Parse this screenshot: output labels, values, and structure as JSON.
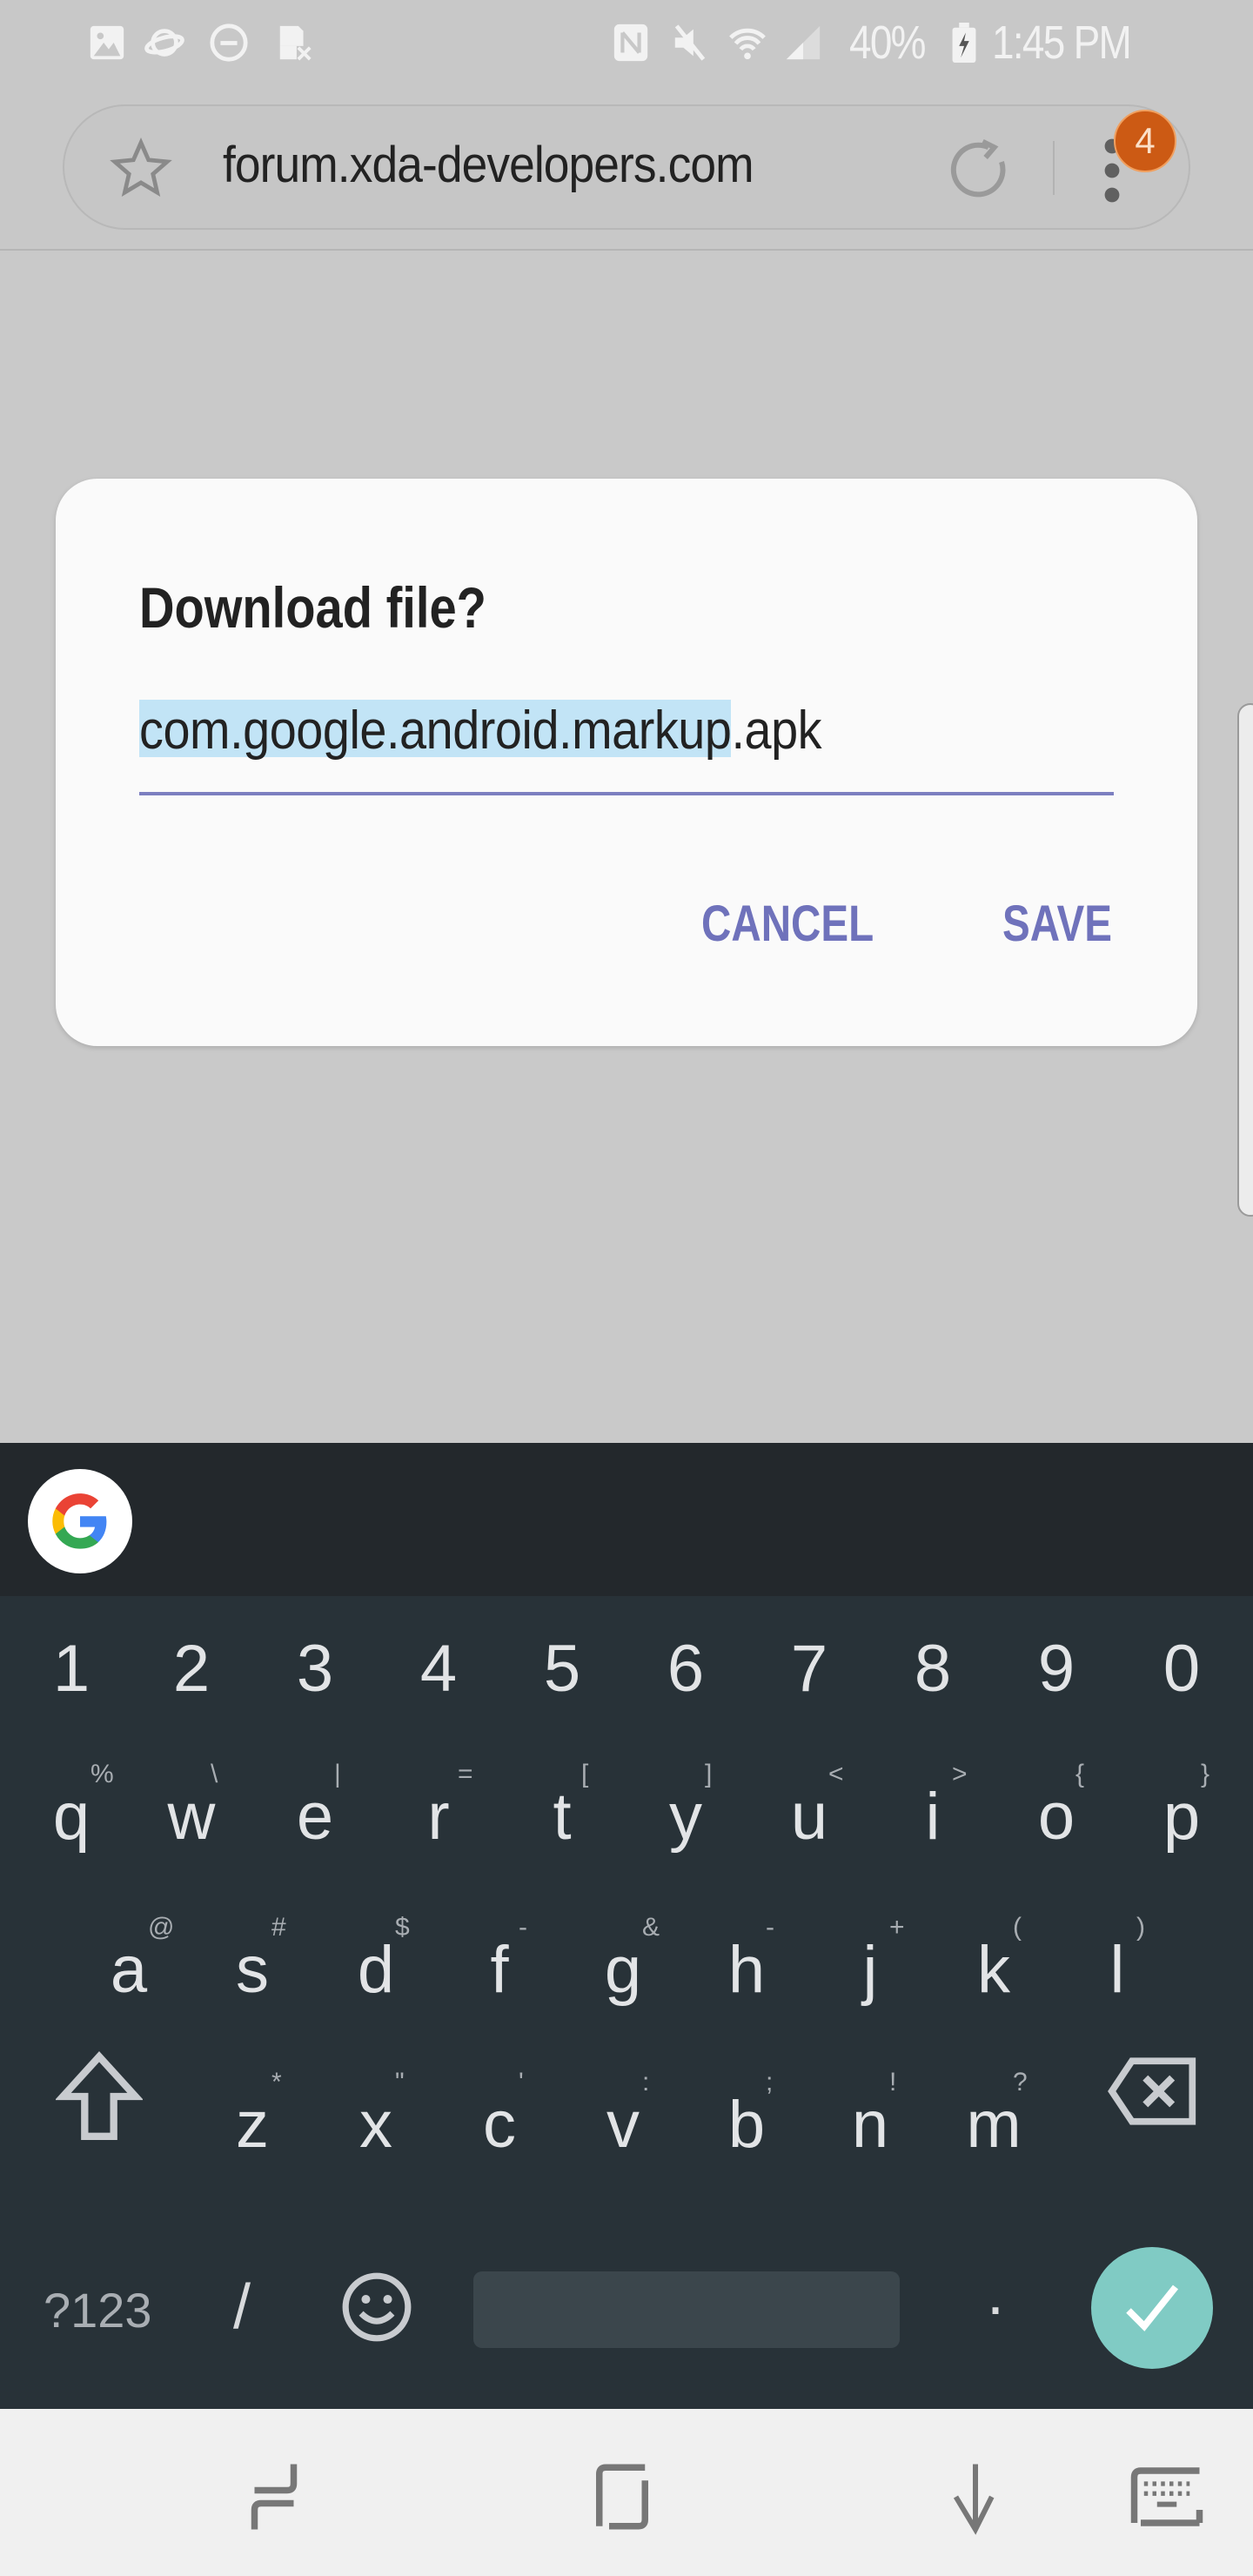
{
  "status_bar": {
    "left_icons": [
      "gallery-icon",
      "samsung-internet-icon",
      "do-not-disturb-icon",
      "screenshot-blocked-icon"
    ],
    "right_icons": [
      "nfc-icon",
      "mute-icon",
      "wifi-icon",
      "signal-icon",
      "battery-charging-icon"
    ],
    "battery": "40%",
    "time": "1:45 PM"
  },
  "browser": {
    "url": "forum.xda-developers.com",
    "menu_badge": "4",
    "icons": [
      "bookmark-star-icon",
      "reload-icon",
      "more-menu-icon"
    ]
  },
  "dialog": {
    "title": "Download file?",
    "filename_selected": "com.google.android.markup",
    "filename_ext": ".apk",
    "cancel_label": "CANCEL",
    "save_label": "SAVE",
    "accent_color": "#6f72bb",
    "selection_color": "#c2e4f6"
  },
  "keyboard": {
    "suggestion_bar": {
      "icon": "google-g-icon"
    },
    "rows": [
      [
        {
          "k": "1"
        },
        {
          "k": "2"
        },
        {
          "k": "3"
        },
        {
          "k": "4"
        },
        {
          "k": "5"
        },
        {
          "k": "6"
        },
        {
          "k": "7"
        },
        {
          "k": "8"
        },
        {
          "k": "9"
        },
        {
          "k": "0"
        }
      ],
      [
        {
          "k": "q",
          "h": "%"
        },
        {
          "k": "w",
          "h": "\\"
        },
        {
          "k": "e",
          "h": "|"
        },
        {
          "k": "r",
          "h": "="
        },
        {
          "k": "t",
          "h": "["
        },
        {
          "k": "y",
          "h": "]"
        },
        {
          "k": "u",
          "h": "<"
        },
        {
          "k": "i",
          "h": ">"
        },
        {
          "k": "o",
          "h": "{"
        },
        {
          "k": "p",
          "h": "}"
        }
      ],
      [
        {
          "k": "a",
          "h": "@"
        },
        {
          "k": "s",
          "h": "#"
        },
        {
          "k": "d",
          "h": "$"
        },
        {
          "k": "f",
          "h": "-"
        },
        {
          "k": "g",
          "h": "&"
        },
        {
          "k": "h",
          "h": "-"
        },
        {
          "k": "j",
          "h": "+"
        },
        {
          "k": "k",
          "h": "("
        },
        {
          "k": "l",
          "h": ")"
        }
      ],
      [
        {
          "k": "z",
          "h": "*"
        },
        {
          "k": "x",
          "h": "\""
        },
        {
          "k": "c",
          "h": "'"
        },
        {
          "k": "v",
          "h": ":"
        },
        {
          "k": "b",
          "h": ";"
        },
        {
          "k": "n",
          "h": "!"
        },
        {
          "k": "m",
          "h": "?"
        }
      ]
    ],
    "symbols_label": "?123",
    "slash_label": "/",
    "period_label": ".",
    "enter_color": "#80cbc4"
  },
  "navbar": {
    "icons": [
      "recents-icon",
      "home-icon",
      "back-icon",
      "keyboard-switch-icon"
    ]
  }
}
